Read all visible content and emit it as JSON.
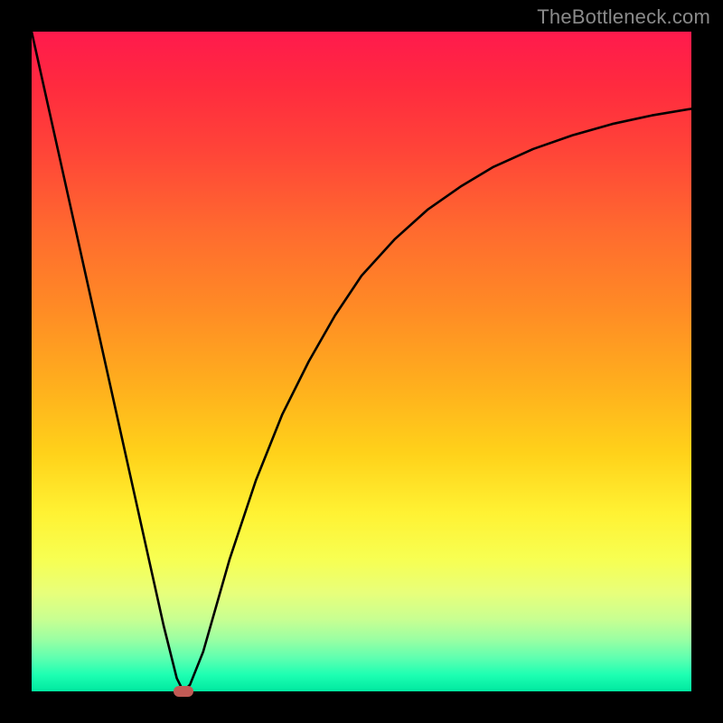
{
  "watermark": "TheBottleneck.com",
  "chart_data": {
    "type": "line",
    "title": "",
    "xlabel": "",
    "ylabel": "",
    "xlim": [
      0,
      100
    ],
    "ylim": [
      0,
      100
    ],
    "x": [
      0,
      4,
      8,
      12,
      16,
      20,
      22,
      23,
      24,
      26,
      28,
      30,
      34,
      38,
      42,
      46,
      50,
      55,
      60,
      65,
      70,
      76,
      82,
      88,
      94,
      100
    ],
    "values": [
      100,
      82,
      64,
      46,
      28,
      10,
      2,
      0,
      1,
      6,
      13,
      20,
      32,
      42,
      50,
      57,
      63,
      68.5,
      73,
      76.5,
      79.5,
      82.2,
      84.3,
      86,
      87.3,
      88.3
    ],
    "minimum": {
      "x": 23,
      "y": 0
    },
    "gradient_stops": [
      {
        "pos": 0.0,
        "color": "#ff1a4d"
      },
      {
        "pos": 0.3,
        "color": "#ff6a2f"
      },
      {
        "pos": 0.6,
        "color": "#ffd21a"
      },
      {
        "pos": 0.8,
        "color": "#f7ff52"
      },
      {
        "pos": 1.0,
        "color": "#00e8a0"
      }
    ]
  }
}
